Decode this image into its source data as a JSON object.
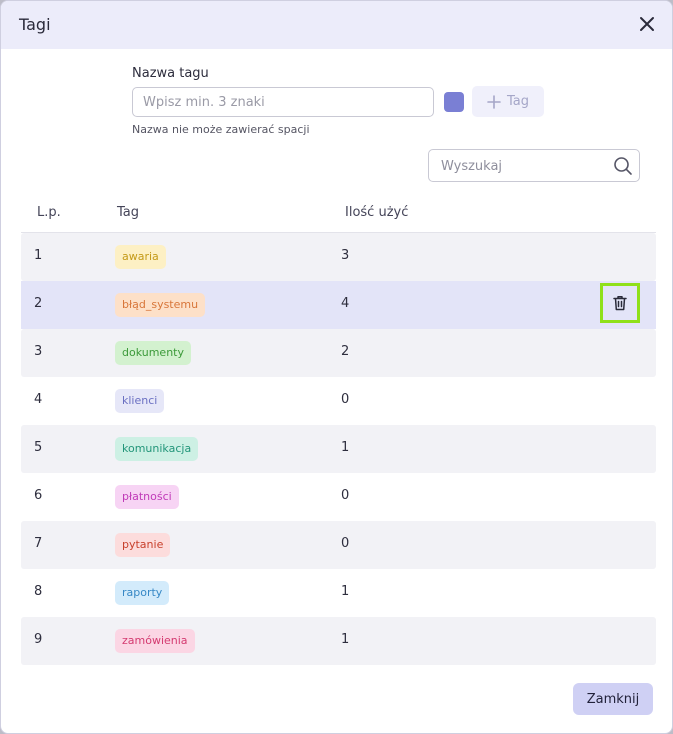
{
  "dialog": {
    "title": "Tagi",
    "name_label": "Nazwa tagu",
    "name_placeholder": "Wpisz min. 3 znaki",
    "name_value": "",
    "swatch_color": "#7a7fd4",
    "add_button_label": "Tag",
    "hint": "Nazwa nie może zawierać spacji",
    "search_placeholder": "Wyszukaj",
    "close_button_label": "Zamknij"
  },
  "table": {
    "headers": {
      "lp": "L.p.",
      "tag": "Tag",
      "count": "Ilość użyć"
    },
    "rows": [
      {
        "lp": "1",
        "tag": "awaria",
        "count": "3",
        "bg": "#fdf0c4",
        "fg": "#c49a18"
      },
      {
        "lp": "2",
        "tag": "błąd_systemu",
        "count": "4",
        "bg": "#fde0c8",
        "fg": "#d8763a"
      },
      {
        "lp": "3",
        "tag": "dokumenty",
        "count": "2",
        "bg": "#d3f1cf",
        "fg": "#3c9a3a"
      },
      {
        "lp": "4",
        "tag": "klienci",
        "count": "0",
        "bg": "#e6e7f8",
        "fg": "#6a6fc2"
      },
      {
        "lp": "5",
        "tag": "komunikacja",
        "count": "1",
        "bg": "#cdf0e4",
        "fg": "#23967a"
      },
      {
        "lp": "6",
        "tag": "płatności",
        "count": "0",
        "bg": "#f7d4f4",
        "fg": "#c03ab8"
      },
      {
        "lp": "7",
        "tag": "pytanie",
        "count": "0",
        "bg": "#fcdcdc",
        "fg": "#c8402c"
      },
      {
        "lp": "8",
        "tag": "raporty",
        "count": "1",
        "bg": "#d3ebfb",
        "fg": "#3688c6"
      },
      {
        "lp": "9",
        "tag": "zamówienia",
        "count": "1",
        "bg": "#fbd6e4",
        "fg": "#d43a70"
      }
    ]
  }
}
